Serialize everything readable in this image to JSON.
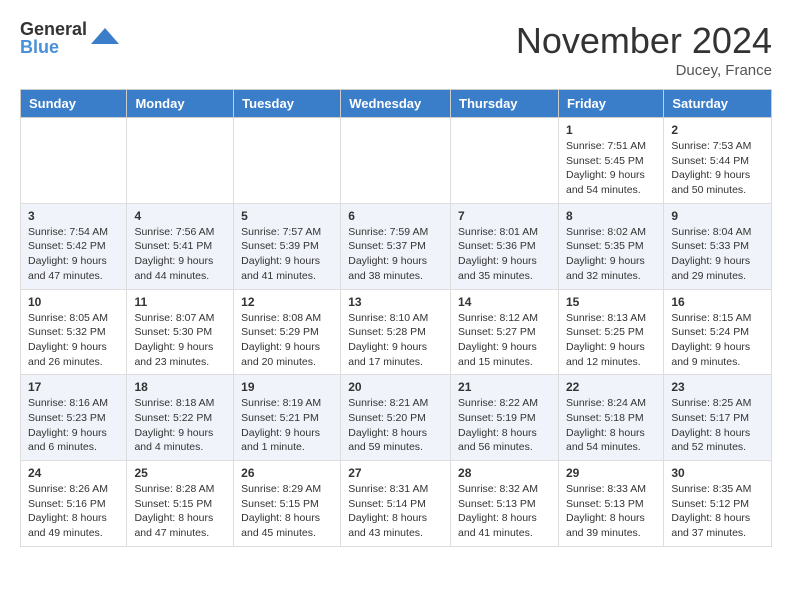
{
  "header": {
    "logo_general": "General",
    "logo_blue": "Blue",
    "month_title": "November 2024",
    "location": "Ducey, France"
  },
  "days_of_week": [
    "Sunday",
    "Monday",
    "Tuesday",
    "Wednesday",
    "Thursday",
    "Friday",
    "Saturday"
  ],
  "weeks": [
    [
      {
        "day": "",
        "info": ""
      },
      {
        "day": "",
        "info": ""
      },
      {
        "day": "",
        "info": ""
      },
      {
        "day": "",
        "info": ""
      },
      {
        "day": "",
        "info": ""
      },
      {
        "day": "1",
        "info": "Sunrise: 7:51 AM\nSunset: 5:45 PM\nDaylight: 9 hours and 54 minutes."
      },
      {
        "day": "2",
        "info": "Sunrise: 7:53 AM\nSunset: 5:44 PM\nDaylight: 9 hours and 50 minutes."
      }
    ],
    [
      {
        "day": "3",
        "info": "Sunrise: 7:54 AM\nSunset: 5:42 PM\nDaylight: 9 hours and 47 minutes."
      },
      {
        "day": "4",
        "info": "Sunrise: 7:56 AM\nSunset: 5:41 PM\nDaylight: 9 hours and 44 minutes."
      },
      {
        "day": "5",
        "info": "Sunrise: 7:57 AM\nSunset: 5:39 PM\nDaylight: 9 hours and 41 minutes."
      },
      {
        "day": "6",
        "info": "Sunrise: 7:59 AM\nSunset: 5:37 PM\nDaylight: 9 hours and 38 minutes."
      },
      {
        "day": "7",
        "info": "Sunrise: 8:01 AM\nSunset: 5:36 PM\nDaylight: 9 hours and 35 minutes."
      },
      {
        "day": "8",
        "info": "Sunrise: 8:02 AM\nSunset: 5:35 PM\nDaylight: 9 hours and 32 minutes."
      },
      {
        "day": "9",
        "info": "Sunrise: 8:04 AM\nSunset: 5:33 PM\nDaylight: 9 hours and 29 minutes."
      }
    ],
    [
      {
        "day": "10",
        "info": "Sunrise: 8:05 AM\nSunset: 5:32 PM\nDaylight: 9 hours and 26 minutes."
      },
      {
        "day": "11",
        "info": "Sunrise: 8:07 AM\nSunset: 5:30 PM\nDaylight: 9 hours and 23 minutes."
      },
      {
        "day": "12",
        "info": "Sunrise: 8:08 AM\nSunset: 5:29 PM\nDaylight: 9 hours and 20 minutes."
      },
      {
        "day": "13",
        "info": "Sunrise: 8:10 AM\nSunset: 5:28 PM\nDaylight: 9 hours and 17 minutes."
      },
      {
        "day": "14",
        "info": "Sunrise: 8:12 AM\nSunset: 5:27 PM\nDaylight: 9 hours and 15 minutes."
      },
      {
        "day": "15",
        "info": "Sunrise: 8:13 AM\nSunset: 5:25 PM\nDaylight: 9 hours and 12 minutes."
      },
      {
        "day": "16",
        "info": "Sunrise: 8:15 AM\nSunset: 5:24 PM\nDaylight: 9 hours and 9 minutes."
      }
    ],
    [
      {
        "day": "17",
        "info": "Sunrise: 8:16 AM\nSunset: 5:23 PM\nDaylight: 9 hours and 6 minutes."
      },
      {
        "day": "18",
        "info": "Sunrise: 8:18 AM\nSunset: 5:22 PM\nDaylight: 9 hours and 4 minutes."
      },
      {
        "day": "19",
        "info": "Sunrise: 8:19 AM\nSunset: 5:21 PM\nDaylight: 9 hours and 1 minute."
      },
      {
        "day": "20",
        "info": "Sunrise: 8:21 AM\nSunset: 5:20 PM\nDaylight: 8 hours and 59 minutes."
      },
      {
        "day": "21",
        "info": "Sunrise: 8:22 AM\nSunset: 5:19 PM\nDaylight: 8 hours and 56 minutes."
      },
      {
        "day": "22",
        "info": "Sunrise: 8:24 AM\nSunset: 5:18 PM\nDaylight: 8 hours and 54 minutes."
      },
      {
        "day": "23",
        "info": "Sunrise: 8:25 AM\nSunset: 5:17 PM\nDaylight: 8 hours and 52 minutes."
      }
    ],
    [
      {
        "day": "24",
        "info": "Sunrise: 8:26 AM\nSunset: 5:16 PM\nDaylight: 8 hours and 49 minutes."
      },
      {
        "day": "25",
        "info": "Sunrise: 8:28 AM\nSunset: 5:15 PM\nDaylight: 8 hours and 47 minutes."
      },
      {
        "day": "26",
        "info": "Sunrise: 8:29 AM\nSunset: 5:15 PM\nDaylight: 8 hours and 45 minutes."
      },
      {
        "day": "27",
        "info": "Sunrise: 8:31 AM\nSunset: 5:14 PM\nDaylight: 8 hours and 43 minutes."
      },
      {
        "day": "28",
        "info": "Sunrise: 8:32 AM\nSunset: 5:13 PM\nDaylight: 8 hours and 41 minutes."
      },
      {
        "day": "29",
        "info": "Sunrise: 8:33 AM\nSunset: 5:13 PM\nDaylight: 8 hours and 39 minutes."
      },
      {
        "day": "30",
        "info": "Sunrise: 8:35 AM\nSunset: 5:12 PM\nDaylight: 8 hours and 37 minutes."
      }
    ]
  ]
}
